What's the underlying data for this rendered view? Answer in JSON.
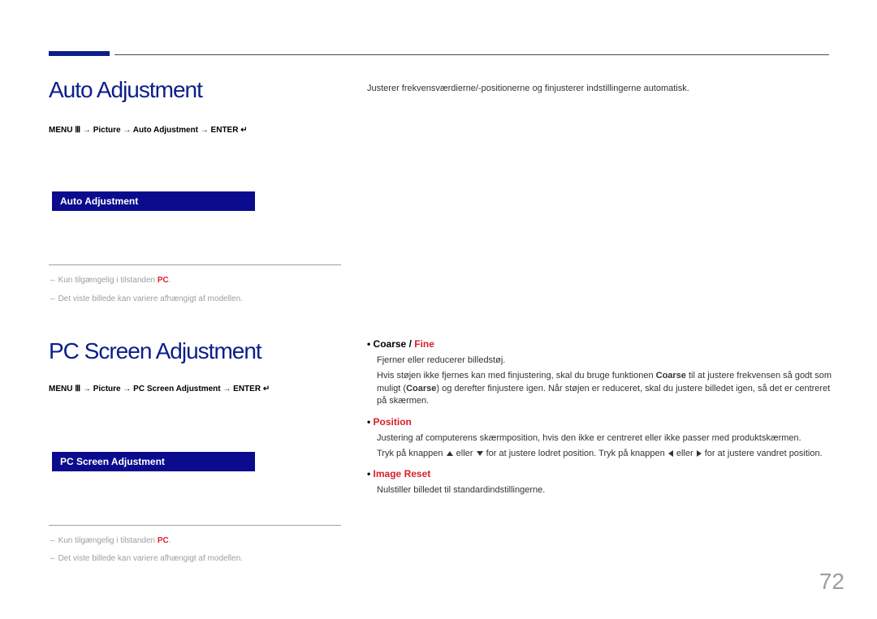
{
  "pageNumber": "72",
  "section1": {
    "title": "Auto Adjustment",
    "breadcrumb": {
      "menu": "MENU Ⅲ",
      "part1": "Picture",
      "part2": "Auto Adjustment",
      "enter": "ENTER ↵"
    },
    "menuLabel": "Auto Adjustment",
    "description": "Justerer frekvensværdierne/-positionerne og finjusterer indstillingerne automatisk.",
    "foot1": {
      "pre": "Kun tilgængelig i tilstanden",
      "kw": "PC",
      "post": "."
    },
    "foot2": "Det viste billede kan variere afhængigt af modellen."
  },
  "section2": {
    "title": "PC Screen Adjustment",
    "breadcrumb": {
      "menu": "MENU Ⅲ",
      "part1": "Picture",
      "part2": "PC Screen Adjustment",
      "enter": "ENTER ↵"
    },
    "menuLabel": "PC Screen Adjustment",
    "foot1": {
      "pre": "Kun tilgængelig i tilstanden",
      "kw": "PC",
      "post": "."
    },
    "foot2": "Det viste billede kan variere afhængigt af modellen.",
    "items": [
      {
        "label": "Coarse",
        "label2": "Fine",
        "line1": "Fjerner eller reducerer billedstøj.",
        "line2a": "Hvis støjen ikke fjernes kan med finjustering, skal du bruge funktionen",
        "kw": "Coarse",
        "line2b": "til at justere frekvensen så godt som muligt",
        "kw2": "Coarse",
        "line2c": "og derefter finjustere igen. Når støjen er reduceret, skal du justere billedet igen, så det er centreret på skærmen."
      },
      {
        "label": "Position",
        "line1": "Justering af computerens skærmposition, hvis den ikke er centreret eller ikke passer med produktskærmen.",
        "line2a": "Tryk på knappen",
        "or": "eller",
        "line2b": "for at justere lodret position. Tryk på knappen",
        "line2c": "for at justere vandret position."
      },
      {
        "label": "Image Reset",
        "line1": "Nulstiller billedet til standardindstillingerne."
      }
    ]
  }
}
